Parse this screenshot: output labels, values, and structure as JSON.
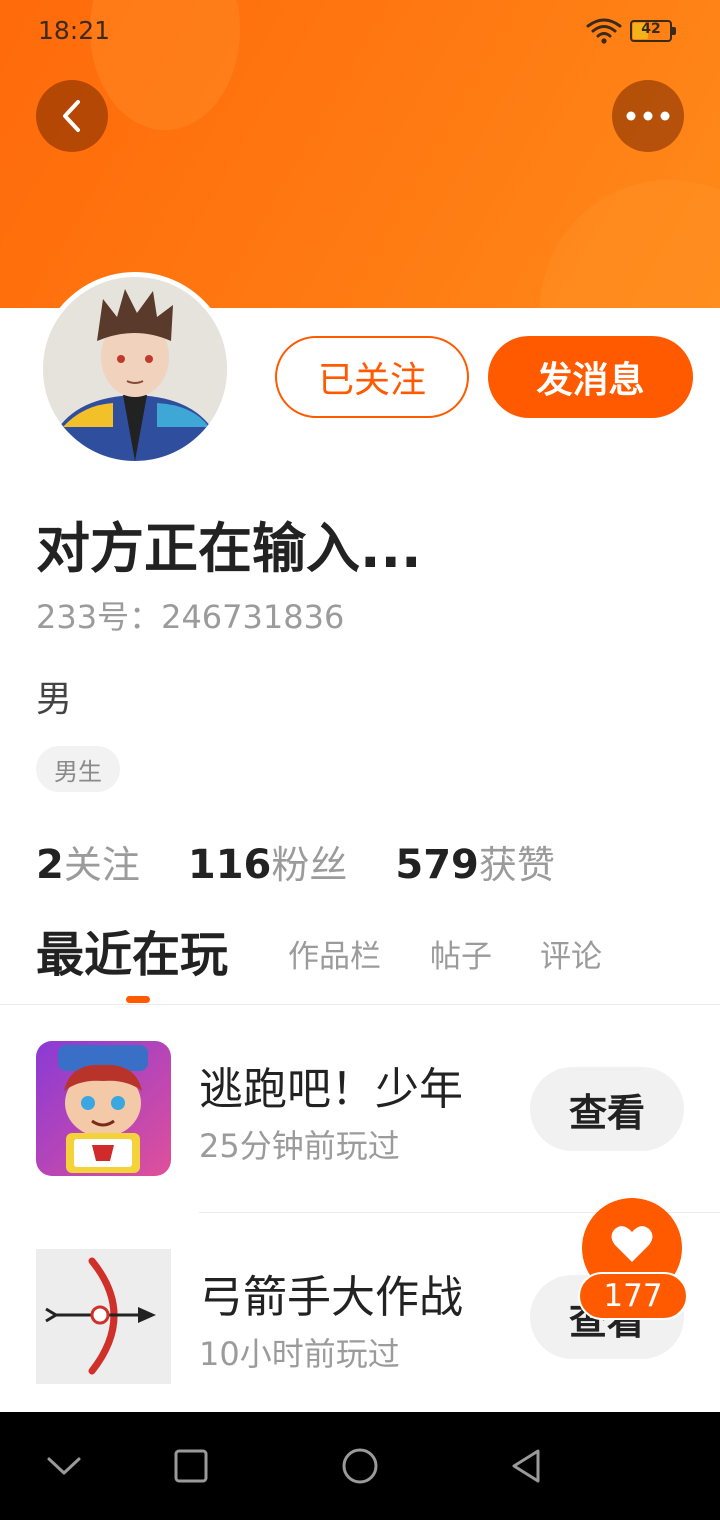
{
  "status_bar": {
    "time": "18:21",
    "battery_level": "42",
    "battery_fraction": 0.42
  },
  "header": {
    "back_icon": "chevron-left-icon",
    "more_icon": "more-dots-icon"
  },
  "profile": {
    "avatar": "avatar-image",
    "follow_label": "已关注",
    "message_label": "发消息",
    "username": "对方正在输入...",
    "id_label": "233号：246731836",
    "gender": "男",
    "tag": "男生"
  },
  "stats": [
    {
      "num": "2",
      "label": "关注"
    },
    {
      "num": "116",
      "label": "粉丝"
    },
    {
      "num": "579",
      "label": "获赞"
    }
  ],
  "tabs": [
    {
      "label": "最近在玩",
      "active": true
    },
    {
      "label": "作品栏",
      "active": false
    },
    {
      "label": "帖子",
      "active": false
    },
    {
      "label": "评论",
      "active": false
    }
  ],
  "games": [
    {
      "title": "逃跑吧！少年",
      "played": "25分钟前玩过",
      "action": "查看"
    },
    {
      "title": "弓箭手大作战",
      "played": "10小时前玩过",
      "action": "查看"
    }
  ],
  "like_fab": {
    "icon": "heart-icon",
    "count": "177"
  },
  "colors": {
    "accent": "#ff5a00",
    "header": "#ff7a12"
  },
  "nav_bar": {
    "icons": [
      "chevron-down-icon",
      "square-icon",
      "circle-icon",
      "triangle-back-icon"
    ]
  }
}
